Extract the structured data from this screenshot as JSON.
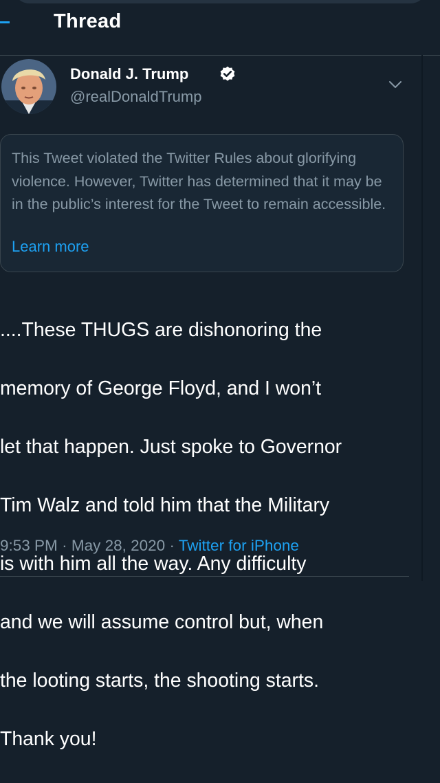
{
  "header": {
    "title": "Thread"
  },
  "tweet": {
    "author": {
      "name": "Donald J. Trump",
      "handle": "@realDonaldTrump",
      "verified": true,
      "avatar_icon": "profile-photo"
    },
    "notice": {
      "text": "This Tweet violated the Twitter Rules about glorifying violence. However, Twitter has determined that it may be in the public’s interest for the Tweet to remain accessible.",
      "link": "Learn more"
    },
    "body_lines": [
      "....These THUGS are dishonoring the",
      "memory of George Floyd, and I won’t",
      "let that happen. Just spoke to Governor",
      "Tim Walz and told him that the Military",
      "is with him all the way. Any difficulty",
      "and we will assume control but, when",
      "the looting starts, the shooting starts.",
      "Thank you!"
    ],
    "time": "9:53 PM",
    "date": "May 28, 2020",
    "separator": "·",
    "source": "Twitter for iPhone"
  },
  "colors": {
    "background": "#15202b",
    "accent": "#1da1f2",
    "secondary_text": "#8899a6",
    "border": "#38444d"
  }
}
